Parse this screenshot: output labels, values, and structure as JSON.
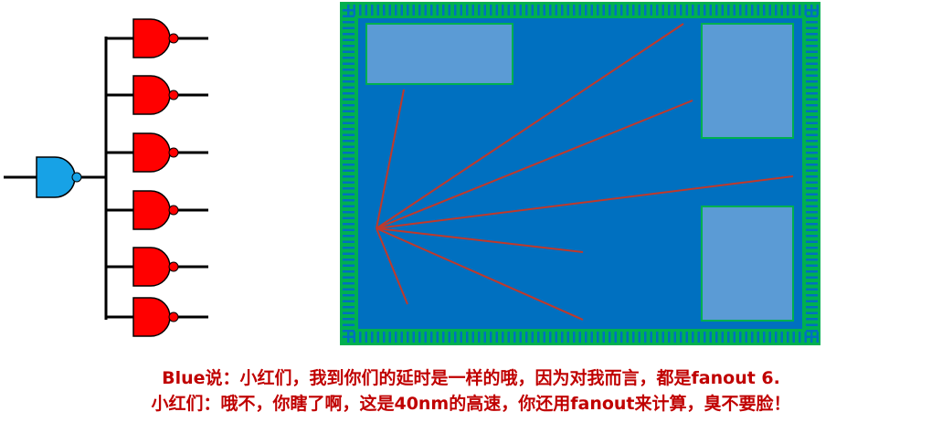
{
  "colors": {
    "driver_gate": "#17a2e6",
    "load_gate": "#ff0000",
    "chip_core": "#0070c0",
    "pad_ring": "#00b050",
    "macro_block": "#5b9bd5",
    "wire": "#c0392b",
    "caption_text": "#c00000"
  },
  "icons": {
    "driver": "nand-gate-icon",
    "load": "nand-gate-icon"
  },
  "diagram": {
    "fanout_count": 6,
    "long_wires_in_chip": 7
  },
  "captions": {
    "line1": "Blue说：小红们，我到你们的延时是一样的哦，因为对我而言，都是fanout 6.",
    "line2": "小红们：哦不，你瞎了啊，这是40nm的高速，你还用fanout来计算，臭不要脸！"
  }
}
